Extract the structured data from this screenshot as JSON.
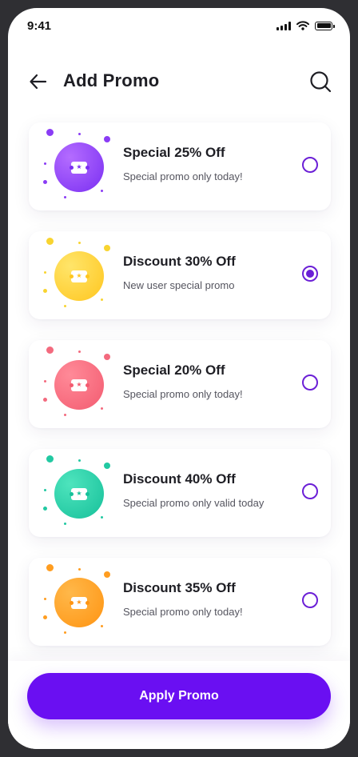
{
  "status_bar": {
    "time": "9:41"
  },
  "header": {
    "title": "Add Promo"
  },
  "promos": [
    {
      "title": "Special 25% Off",
      "subtitle": "Special promo only today!",
      "selected": false,
      "color_light": "#b46cff",
      "color_dark": "#7a2ff2",
      "dot_color": "#8a3cf5"
    },
    {
      "title": "Discount 30% Off",
      "subtitle": "New user special promo",
      "selected": true,
      "color_light": "#ffe56a",
      "color_dark": "#ffc61f",
      "dot_color": "#f8d430"
    },
    {
      "title": "Special 20% Off",
      "subtitle": "Special promo only today!",
      "selected": false,
      "color_light": "#ff8a98",
      "color_dark": "#f35b70",
      "dot_color": "#f36a7e"
    },
    {
      "title": "Discount 40% Off",
      "subtitle": "Special promo only valid today",
      "selected": false,
      "color_light": "#4ee4bd",
      "color_dark": "#16c09a",
      "dot_color": "#22c9a2"
    },
    {
      "title": "Discount 35% Off",
      "subtitle": "Special promo only today!",
      "selected": false,
      "color_light": "#ffb84a",
      "color_dark": "#ff9412",
      "dot_color": "#ff9d20"
    }
  ],
  "footer": {
    "apply_label": "Apply Promo"
  },
  "colors": {
    "accent": "#6a0ff2",
    "radio": "#6b1fd6"
  },
  "icons": {
    "back": "arrow-left-icon",
    "search": "search-icon",
    "promo": "ticket-icon"
  }
}
